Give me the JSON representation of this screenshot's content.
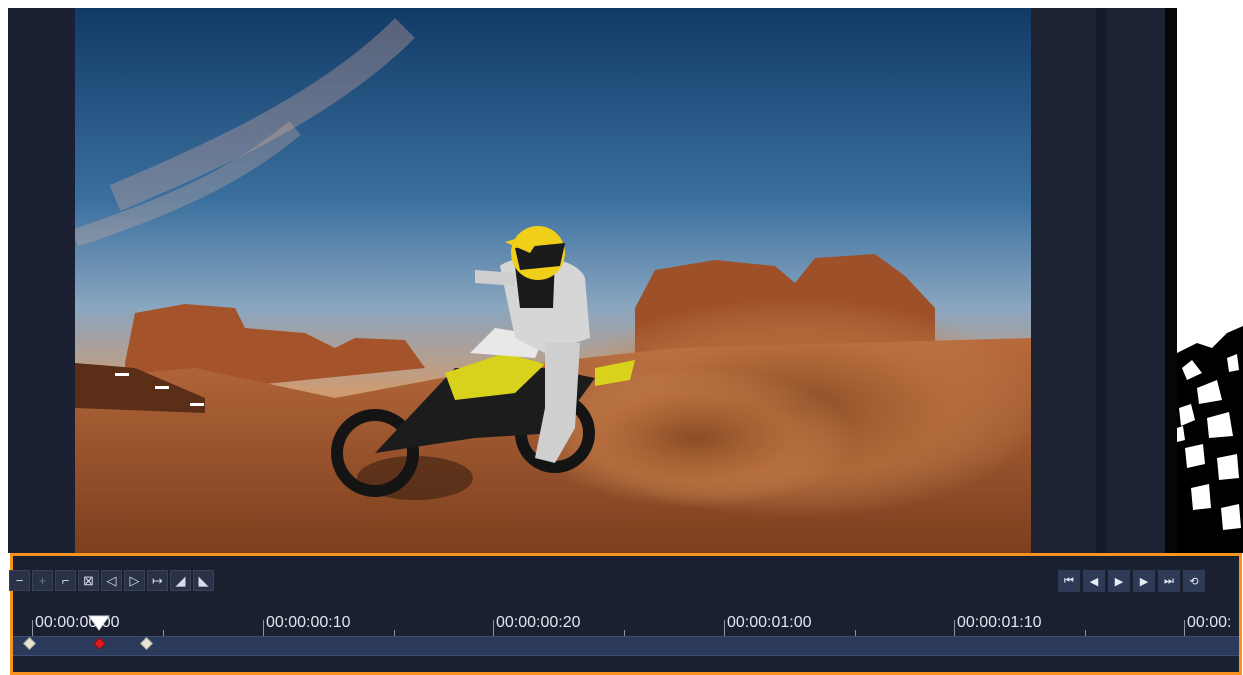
{
  "preview": {
    "scene": "motocross-desert"
  },
  "toolbar": {
    "left_buttons": [
      {
        "name": "remove-keyframe-button",
        "icon": "minus-icon",
        "glyph": "−"
      },
      {
        "name": "add-keyframe-button",
        "icon": "plus-icon",
        "glyph": "+"
      },
      {
        "name": "remove-segment-button",
        "icon": "minus-bracket-icon",
        "glyph": "⌐"
      },
      {
        "name": "reset-keyframes-button",
        "icon": "reset-icon",
        "glyph": "⊠"
      },
      {
        "name": "prev-keyframe-button",
        "icon": "prev-keyframe-icon",
        "glyph": "◁"
      },
      {
        "name": "next-keyframe-button",
        "icon": "next-keyframe-icon",
        "glyph": "▷"
      },
      {
        "name": "move-keyframe-button",
        "icon": "arrow-right-icon",
        "glyph": "↦"
      },
      {
        "name": "fade-in-button",
        "icon": "fade-in-icon",
        "glyph": "◢"
      },
      {
        "name": "fade-out-button",
        "icon": "fade-out-icon",
        "glyph": "◣"
      }
    ],
    "playback_buttons": [
      {
        "name": "go-to-start-button",
        "icon": "skip-start-icon",
        "glyph": "⏮"
      },
      {
        "name": "step-back-button",
        "icon": "step-back-icon",
        "glyph": "◀"
      },
      {
        "name": "play-button",
        "icon": "play-icon",
        "glyph": "▶"
      },
      {
        "name": "step-forward-button",
        "icon": "step-forward-icon",
        "glyph": "▶"
      },
      {
        "name": "go-to-end-button",
        "icon": "skip-end-icon",
        "glyph": "⏭"
      },
      {
        "name": "repeat-button",
        "icon": "repeat-icon",
        "glyph": "⟲"
      }
    ]
  },
  "ruler": {
    "labels": [
      "00:00:00:00",
      "00:00:00:10",
      "00:00:00:20",
      "00:00:01:00",
      "00:00:01:10",
      "00:00:"
    ]
  },
  "colors": {
    "accent": "#f7931e",
    "panel": "#1a2030",
    "track": "#2b3a5a",
    "active_keyframe": "#e01b24"
  }
}
